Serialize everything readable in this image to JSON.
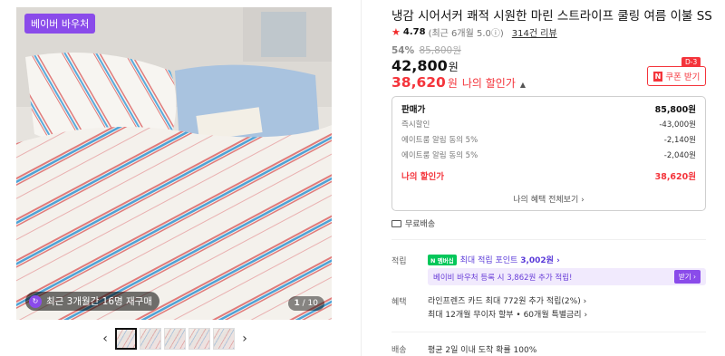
{
  "gallery": {
    "badge": "베이버 바우처",
    "restock_label": "최근 3개월간 16명 재구매",
    "counter_current": "1",
    "counter_total": "/ 10",
    "prev_arrow": "‹",
    "next_arrow": "›"
  },
  "product": {
    "title": "냉감 시어서커 쾌적 시원한 마린 스트라이프 쿨링 여름 이불 SS",
    "rating": "4.78",
    "rating_sub": "(최근 6개월 5.0ⓘ)",
    "reviews": "314건 리뷰",
    "discount_pct": "54%",
    "original_price": "85,800원",
    "sale_price": "42,800",
    "won": "원",
    "my_price": "38,620",
    "my_price_label": "나의 할인가",
    "coupon_label": "쿠폰 받기",
    "coupon_n": "N",
    "dday": "D-3"
  },
  "price_box": {
    "rows": [
      {
        "label": "판매가",
        "value": "85,800원"
      },
      {
        "label": "즉시할인",
        "value": "-43,000원"
      },
      {
        "label": "에이트룸 알림 동의 5%",
        "value": "-2,140원"
      },
      {
        "label": "에이트룸 알림 동의 5%",
        "value": "-2,040원"
      },
      {
        "label": "나의 할인가",
        "value": "38,620원"
      }
    ],
    "all_benefits": "나의 혜택 전체보기 ›"
  },
  "shipping": {
    "free": "무료배송"
  },
  "accumulate": {
    "label": "적립",
    "npay": "N 멤버십",
    "points_text": "최대 적립 포인트",
    "points_value": "3,002원 ›",
    "baby_text": "베이비 바우처 등록 시 3,862원 추가 적립!",
    "baby_button": "받기 ›"
  },
  "benefit": {
    "label": "혜택",
    "line1": "라인프렌즈 카드 최대 772원 추가 적립(2%) ›",
    "line2": "최대 12개월 무이자 할부 • 60개월 특별금리 ›"
  },
  "delivery": {
    "label": "배송",
    "text": "평균 2일 이내 도착 확률 100%"
  },
  "colors": {
    "accent_red": "#f4343b",
    "purple": "#8a4bea",
    "npay_green": "#03c75a"
  }
}
